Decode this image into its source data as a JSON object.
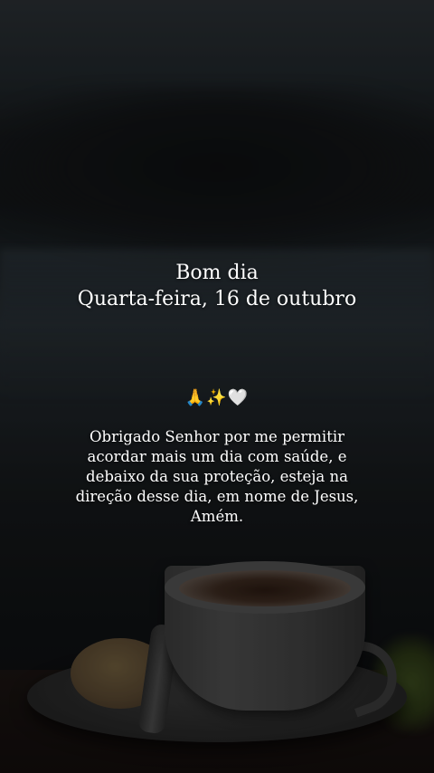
{
  "story": {
    "greeting_line1": "Bom dia",
    "greeting_line2": "Quarta-feira, 16 de outubro",
    "emojis": {
      "pray": "🙏",
      "sparkles": "✨",
      "heart": "🤍"
    },
    "prayer_text": "Obrigado Senhor por me permitir acordar mais um dia com saúde, e debaixo da sua proteção, esteja na direção desse dia, em nome de Jesus, Amém."
  },
  "colors": {
    "text": "#ffffff",
    "background_dark": "#111417"
  },
  "icons": [
    "pray-emoji-icon",
    "sparkles-emoji-icon",
    "white-heart-emoji-icon"
  ]
}
